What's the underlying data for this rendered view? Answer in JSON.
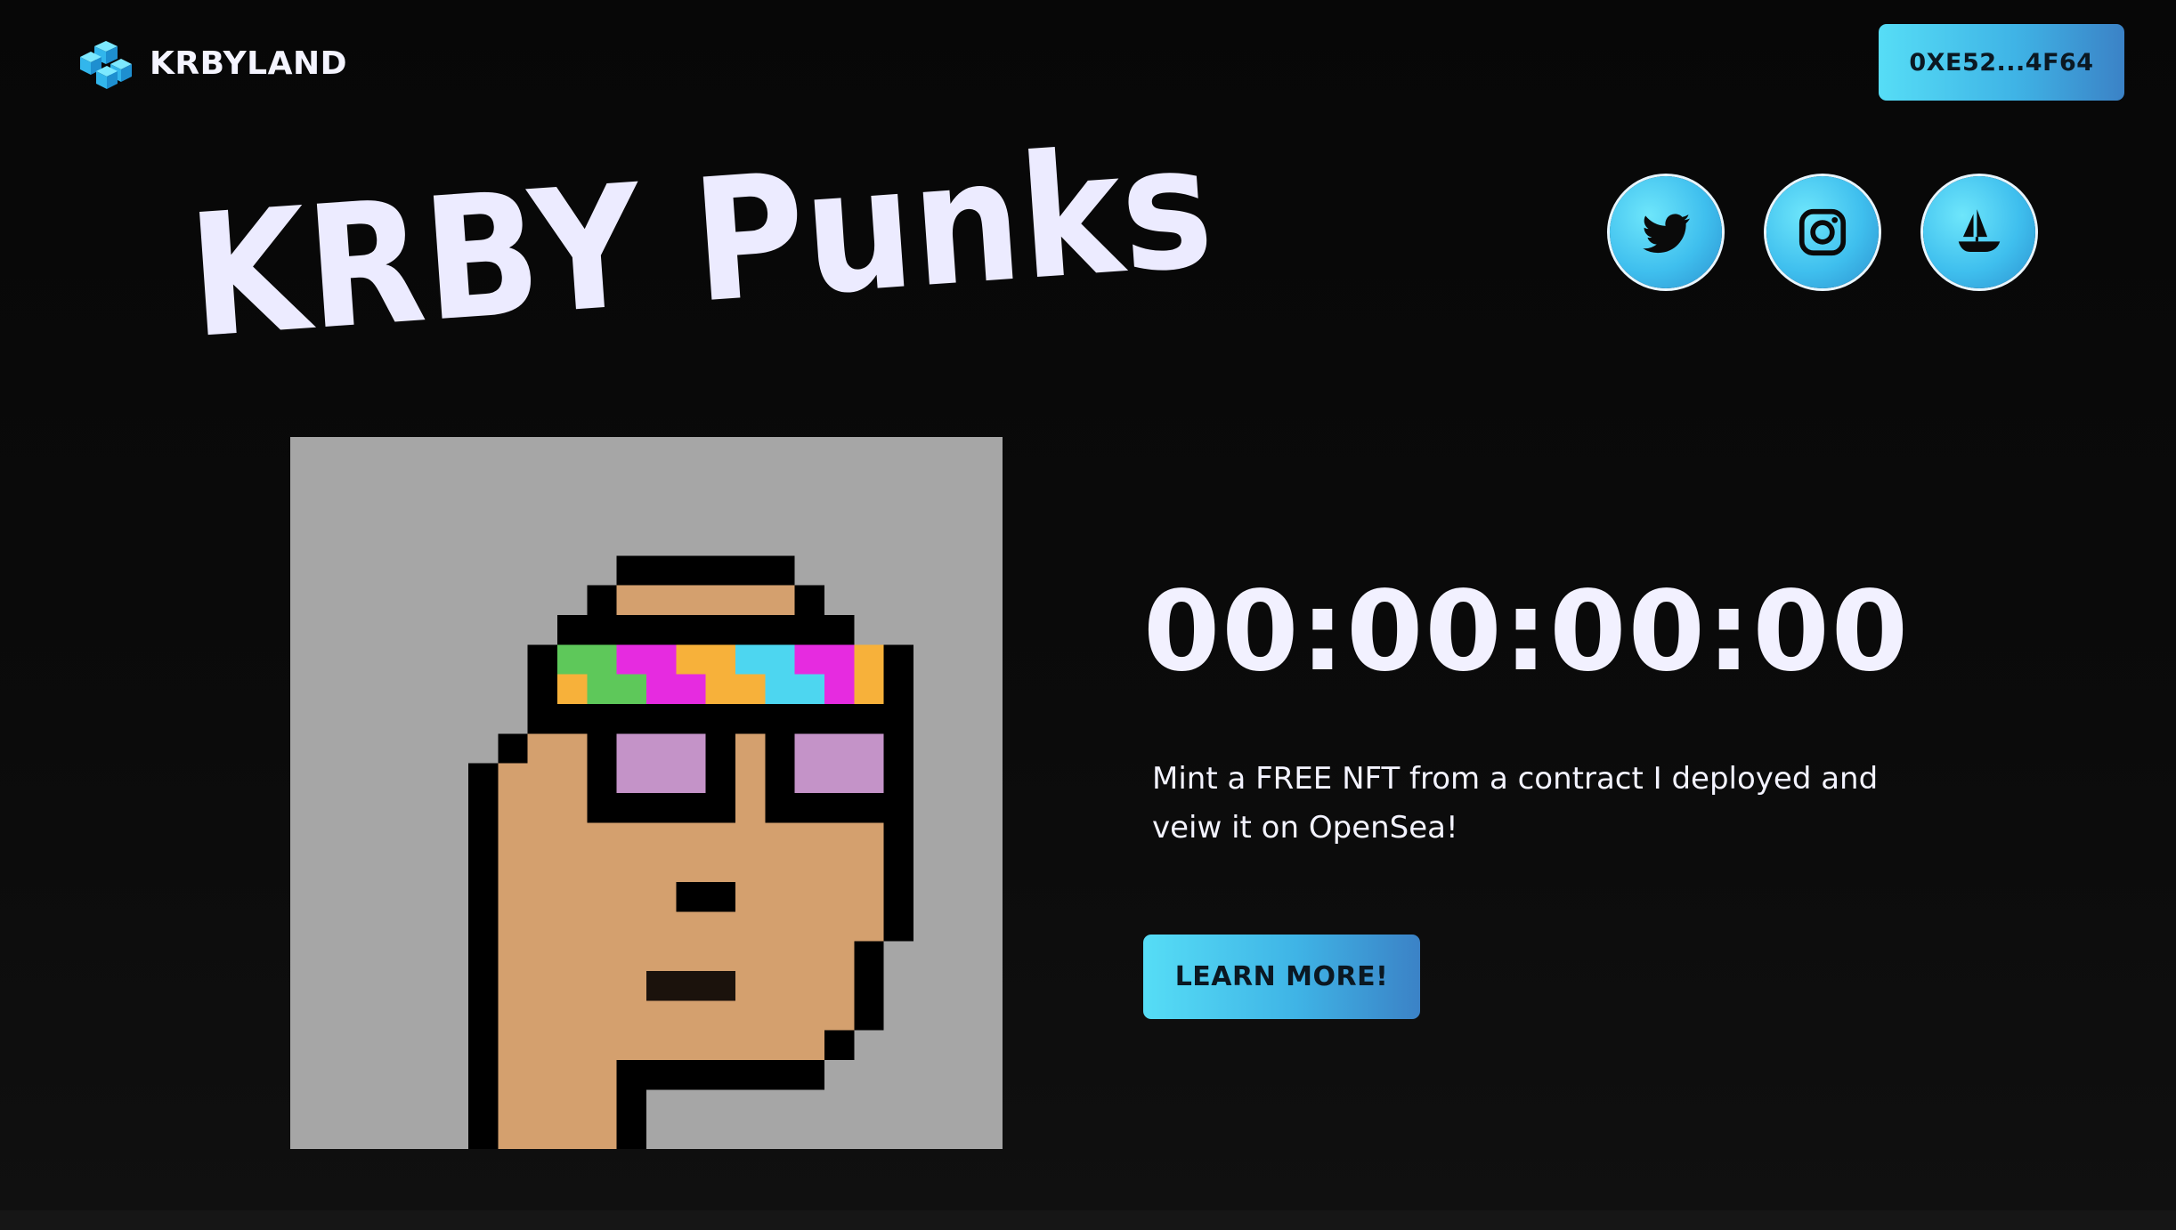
{
  "header": {
    "brand_name": "KRBYLAND",
    "brand_icon": "isometric-cubes-logo",
    "wallet_label": "0XE52...4F64"
  },
  "hero": {
    "title": "KRBY Punks"
  },
  "social_links": [
    {
      "name": "twitter",
      "icon": "twitter-bird-icon"
    },
    {
      "name": "instagram",
      "icon": "instagram-camera-icon"
    },
    {
      "name": "opensea",
      "icon": "opensea-boat-icon"
    }
  ],
  "mint": {
    "countdown": "00:00:00:00",
    "description": "Mint a FREE NFT from a contract I deployed and veiw it on OpenSea!",
    "cta_label": "LEARN MORE!"
  },
  "colors": {
    "background": "#0a0a0a",
    "accent_start": "#56ddf6",
    "accent_end": "#3b82c6",
    "text": "#f0efff",
    "punk_background": "#a6a6a6"
  }
}
